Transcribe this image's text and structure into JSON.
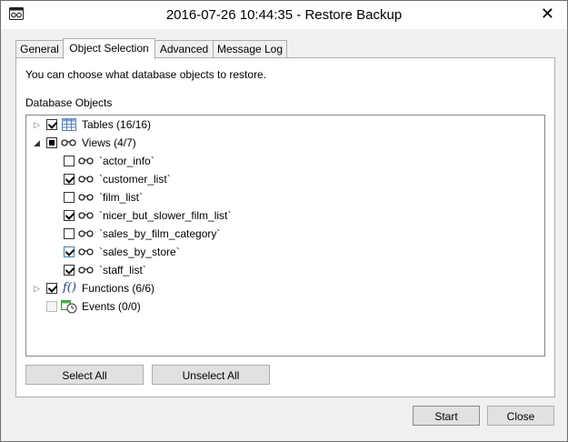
{
  "window": {
    "title": "2016-07-26 10:44:35 - Restore Backup",
    "close_glyph": "✕"
  },
  "tabs": [
    {
      "label": "General"
    },
    {
      "label": "Object Selection"
    },
    {
      "label": "Advanced"
    },
    {
      "label": "Message Log"
    }
  ],
  "active_tab": "Object Selection",
  "panel": {
    "description": "You can choose what database objects to restore.",
    "group_label": "Database Objects"
  },
  "tree": {
    "tables": {
      "label": "Tables (16/16)",
      "state": "checked",
      "expanded": false
    },
    "views": {
      "label": "Views (4/7)",
      "state": "indeterminate",
      "expanded": true,
      "items": [
        {
          "label": "`actor_info`",
          "checked": false
        },
        {
          "label": "`customer_list`",
          "checked": true
        },
        {
          "label": "`film_list`",
          "checked": false
        },
        {
          "label": "`nicer_but_slower_film_list`",
          "checked": true
        },
        {
          "label": "`sales_by_film_category`",
          "checked": false
        },
        {
          "label": "`sales_by_store`",
          "checked": true
        },
        {
          "label": "`staff_list`",
          "checked": true
        }
      ]
    },
    "functions": {
      "label": "Functions (6/6)",
      "state": "checked",
      "expanded": false
    },
    "events": {
      "label": "Events (0/0)",
      "state": "disabled"
    }
  },
  "buttons": {
    "select_all": "Select All",
    "unselect_all": "Unselect All",
    "start": "Start",
    "close": "Close"
  }
}
